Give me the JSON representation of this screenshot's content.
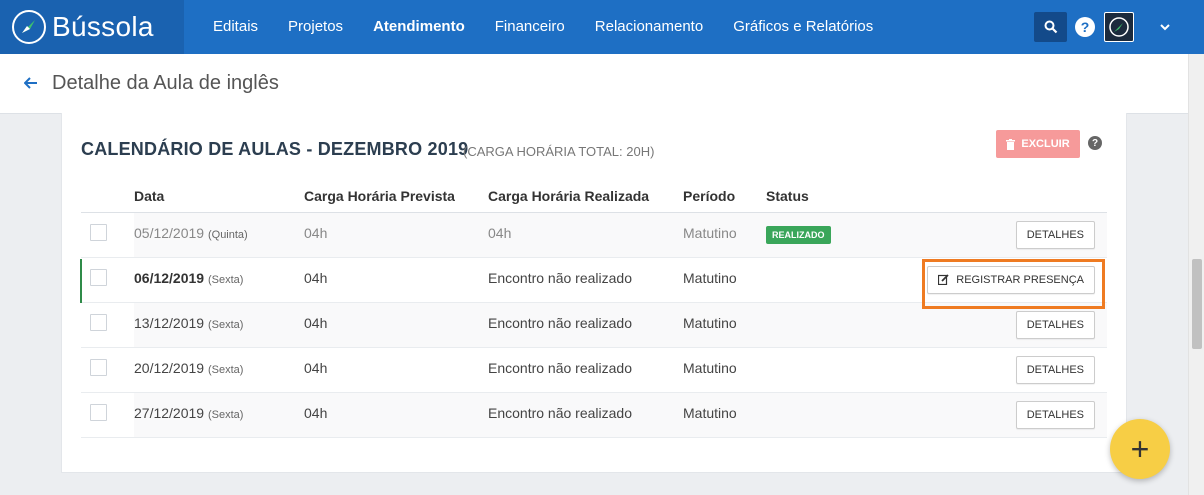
{
  "app": {
    "name": "Bússola"
  },
  "nav": {
    "items": [
      {
        "label": "Editais"
      },
      {
        "label": "Projetos"
      },
      {
        "label": "Atendimento"
      },
      {
        "label": "Financeiro"
      },
      {
        "label": "Relacionamento"
      },
      {
        "label": "Gráficos e Relatórios"
      }
    ],
    "active": "Atendimento",
    "help_label": "?"
  },
  "page": {
    "title": "Detalhe da Aula de inglês"
  },
  "calendar": {
    "title": "CALENDÁRIO DE AULAS - DEZEMBRO 2019",
    "subtitle": "(CARGA HORÁRIA TOTAL: 20H)",
    "delete_label": "EXCLUIR",
    "help_label": "?",
    "columns": [
      "Data",
      "Carga Horária Prevista",
      "Carga Horária Realizada",
      "Período",
      "Status"
    ],
    "rows": [
      {
        "date": "05/12/2019",
        "weekday": "(Quinta)",
        "prevista": "04h",
        "realizada": "04h",
        "periodo": "Matutino",
        "status": "REALIZADO",
        "action": "DETALHES"
      },
      {
        "date": "06/12/2019",
        "weekday": "(Sexta)",
        "prevista": "04h",
        "realizada": "Encontro não realizado",
        "periodo": "Matutino",
        "status": "",
        "action": "REGISTRAR PRESENÇA"
      },
      {
        "date": "13/12/2019",
        "weekday": "(Sexta)",
        "prevista": "04h",
        "realizada": "Encontro não realizado",
        "periodo": "Matutino",
        "status": "",
        "action": "DETALHES"
      },
      {
        "date": "20/12/2019",
        "weekday": "(Sexta)",
        "prevista": "04h",
        "realizada": "Encontro não realizado",
        "periodo": "Matutino",
        "status": "",
        "action": "DETALHES"
      },
      {
        "date": "27/12/2019",
        "weekday": "(Sexta)",
        "prevista": "04h",
        "realizada": "Encontro não realizado",
        "periodo": "Matutino",
        "status": "",
        "action": "DETALHES"
      }
    ]
  },
  "fab": {
    "label": "+"
  },
  "colors": {
    "primary": "#1e6fc4",
    "success": "#3aa65a",
    "danger": "#f69a9a",
    "highlight": "#ef7b22",
    "fab": "#f7ce45"
  }
}
